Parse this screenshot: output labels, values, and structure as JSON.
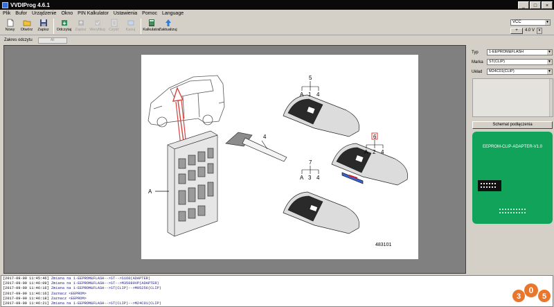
{
  "window": {
    "title": "VVDIProg 4.6.1"
  },
  "menu": [
    "Plik",
    "Bufor",
    "Urządzenie",
    "Okno",
    "PIN Kalkulator",
    "Ustawienia",
    "Pomoc",
    "Language"
  ],
  "toolbar": {
    "buttons": [
      {
        "label": "Nowy",
        "icon": "new-file-icon",
        "enabled": true
      },
      {
        "label": "Otwórz",
        "icon": "open-folder-icon",
        "enabled": true
      },
      {
        "label": "Zapisz",
        "icon": "save-disk-icon",
        "enabled": true
      },
      {
        "label": "Odczytaj",
        "icon": "read-chip-icon",
        "enabled": true
      },
      {
        "label": "Zapisz",
        "icon": "write-chip-icon",
        "enabled": false
      },
      {
        "label": "Weryfikuj",
        "icon": "verify-icon",
        "enabled": false
      },
      {
        "label": "Czyść",
        "icon": "erase-icon",
        "enabled": false
      },
      {
        "label": "Kasuj",
        "icon": "clear-icon",
        "enabled": false
      },
      {
        "label": "Kalkulator",
        "icon": "calculator-icon",
        "enabled": true
      },
      {
        "label": "Zaktualizuj",
        "icon": "update-arrow-icon",
        "enabled": true
      }
    ]
  },
  "power": {
    "source": "VCC",
    "plus_label": "+",
    "voltage": "4.0 V"
  },
  "read_range": {
    "label": "Zakres odczytu",
    "value": "All"
  },
  "panel": {
    "type_label": "Typ",
    "type_value": "1-EEPROM&FLASH",
    "brand_label": "Marka",
    "brand_value": "ST(CLIP)",
    "chip_label": "Układ",
    "chip_value": "M24C01(CLIP)",
    "schematic_button": "Schemat podłączenia",
    "adapter_title": "EEPROM-CLIP-ADAPTER-V1.0"
  },
  "diagram": {
    "callouts": [
      "5",
      "A",
      "1",
      "4",
      "6",
      "A",
      "2",
      "4",
      "7",
      "A",
      "3",
      "4",
      "4",
      "A"
    ],
    "figure_number": "483101"
  },
  "log": [
    {
      "time": "[2017-09-09 11:45:46]",
      "text": "Zmiana na 1-EEPROM&FLASH-->ST-->S160(ADAPTER)"
    },
    {
      "time": "[2017-09-09 11:46:09]",
      "text": "Zmiana na 1-EEPROM&FLASH-->ST-->M35080VP(ADAPTER)"
    },
    {
      "time": "[2017-09-09 11:46:16]",
      "text": "Zmiana na 1-EEPROM&FLASH-->ST(CLIP)-->M95256(CLIP)"
    },
    {
      "time": "[2017-09-09 11:46:16]",
      "text": "Zaznacz <EEPROM>"
    },
    {
      "time": "[2017-09-09 11:46:18]",
      "text": "Zaznacz <EEPROM>"
    },
    {
      "time": "[2017-09-09 11:46:21]",
      "text": "Zmiana na 1-EEPROM&FLASH-->ST(CLIP)-->M24C01(CLIP)"
    }
  ],
  "watermark": {
    "digits": [
      "3",
      "0",
      "5"
    ]
  },
  "colors": {
    "adapter_green": "#12a35a",
    "arrow_red": "#d9413a",
    "log_text": "#1a1a80"
  }
}
